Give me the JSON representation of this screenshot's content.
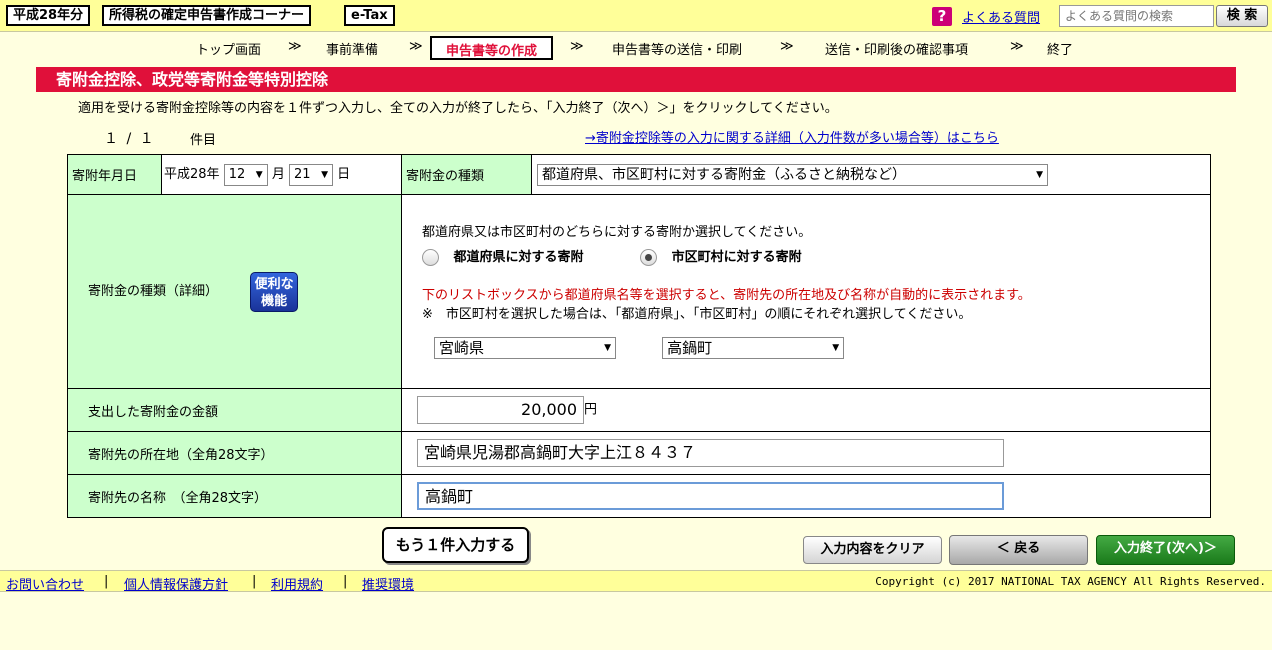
{
  "header": {
    "year_badge": "平成28年分",
    "corner_badge": "所得税の確定申告書作成コーナー",
    "etax_badge": "e-Tax",
    "help_icon_glyph": "?",
    "faq_link": "よくある質問",
    "search_placeholder": "よくある質問の検索",
    "search_button": "検 索"
  },
  "steps": {
    "items": [
      "トップ画面",
      "事前準備",
      "申告書等の作成",
      "申告書等の送信・印刷",
      "送信・印刷後の確認事項",
      "終了"
    ],
    "separator": "≫",
    "active_index": 2
  },
  "page": {
    "title": "寄附金控除、政党等寄附金等特別控除",
    "instruction": "適用を受ける寄附金控除等の内容を１件ずつ入力し、全ての入力が終了したら、「入力終了（次へ）＞」をクリックしてください。",
    "count": "１ / １",
    "count_unit": "件目",
    "detail_link": "→寄附金控除等の入力に関する詳細（入力件数が多い場合等）はこちら"
  },
  "form": {
    "date_label": "寄附年月日",
    "era_prefix": "平成28年",
    "month_value": "12",
    "month_unit": "月",
    "day_value": "21",
    "day_unit": "日",
    "type_label": "寄附金の種類",
    "type_value": "都道府県、市区町村に対する寄附金（ふるさと納税など）",
    "detail_label": "寄附金の種類（詳細）",
    "benri_line1": "便利な",
    "benri_line2": "機能",
    "choose_text": "都道府県又は市区町村のどちらに対する寄附か選択してください。",
    "radio_pref_label": "都道府県に対する寄附",
    "radio_city_label": "市区町村に対する寄附",
    "red_note": "下のリストボックスから都道府県名等を選択すると、寄附先の所在地及び名称が自動的に表示されます。",
    "note": "※　市区町村を選択した場合は、「都道府県」、「市区町村」の順にそれぞれ選択してください。",
    "prefecture_value": "宮崎県",
    "city_value": "高鍋町",
    "amount_label": "支出した寄附金の金額",
    "amount_value": "20,000",
    "amount_unit": "円",
    "address_label": "寄附先の所在地（全角28文字）",
    "address_value": "宮崎県児湯郡高鍋町大字上江８４３７",
    "name_label": "寄附先の名称　（全角28文字）",
    "name_value": "高鍋町"
  },
  "buttons": {
    "add_more": "もう１件入力する",
    "clear": "入力内容をクリア",
    "back": "＜ 戻る",
    "next": "入力終了(次へ)＞"
  },
  "footer": {
    "links": [
      "お問い合わせ",
      "個人情報保護方針",
      "利用規約",
      "推奨環境"
    ],
    "separator": "|",
    "copyright": "Copyright (c) 2017 NATIONAL TAX AGENCY All Rights Reserved."
  },
  "colors": {
    "page_bg": "#ffffe0",
    "bar_bg": "#ffff99",
    "accent_red": "#e0103a",
    "label_green": "#ccffcc",
    "next_green": "#1a7a1a",
    "link_blue": "#0000cc"
  }
}
